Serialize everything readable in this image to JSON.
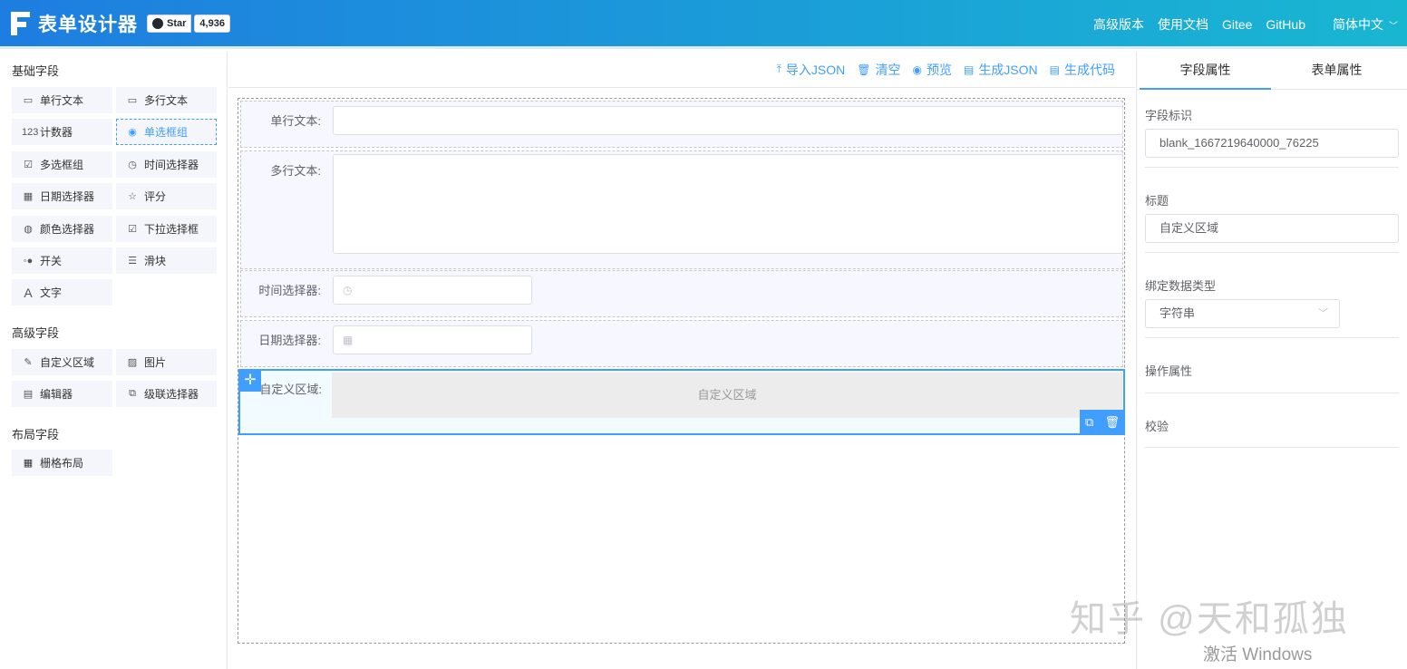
{
  "header": {
    "title": "表单设计器",
    "github": {
      "star_label": "Star",
      "count": "4,936"
    },
    "nav": [
      "高级版本",
      "使用文档",
      "Gitee",
      "GitHub",
      "简体中文"
    ]
  },
  "left": {
    "groups": [
      {
        "title": "基础字段",
        "items": [
          {
            "label": "单行文本",
            "icon": "input-icon"
          },
          {
            "label": "多行文本",
            "icon": "textarea-icon"
          },
          {
            "label": "计数器",
            "icon": "number-icon"
          },
          {
            "label": "单选框组",
            "icon": "radio-icon"
          },
          {
            "label": "多选框组",
            "icon": "checkbox-icon"
          },
          {
            "label": "时间选择器",
            "icon": "clock-icon"
          },
          {
            "label": "日期选择器",
            "icon": "calendar-icon"
          },
          {
            "label": "评分",
            "icon": "star-icon"
          },
          {
            "label": "颜色选择器",
            "icon": "palette-icon"
          },
          {
            "label": "下拉选择框",
            "icon": "select-icon"
          },
          {
            "label": "开关",
            "icon": "switch-icon"
          },
          {
            "label": "滑块",
            "icon": "slider-icon"
          },
          {
            "label": "文字",
            "icon": "text-icon"
          }
        ]
      },
      {
        "title": "高级字段",
        "items": [
          {
            "label": "自定义区域",
            "icon": "edit-icon"
          },
          {
            "label": "图片",
            "icon": "image-icon"
          },
          {
            "label": "编辑器",
            "icon": "editor-icon"
          },
          {
            "label": "级联选择器",
            "icon": "cascader-icon"
          }
        ]
      },
      {
        "title": "布局字段",
        "items": [
          {
            "label": "栅格布局",
            "icon": "grid-icon"
          }
        ]
      }
    ]
  },
  "toolbar": {
    "import_json": "导入JSON",
    "clear": "清空",
    "preview": "预览",
    "gen_json": "生成JSON",
    "gen_code": "生成代码"
  },
  "form": {
    "rows": [
      {
        "label": "单行文本:"
      },
      {
        "label": "多行文本:"
      },
      {
        "label": "时间选择器:"
      },
      {
        "label": "日期选择器:"
      },
      {
        "label": "自定义区域:",
        "content": "自定义区域"
      }
    ]
  },
  "right": {
    "tabs": [
      "字段属性",
      "表单属性"
    ],
    "field_id_label": "字段标识",
    "field_id_value": "blank_1667219640000_76225",
    "title_label": "标题",
    "title_value": "自定义区域",
    "data_type_label": "绑定数据类型",
    "data_type_value": "字符串",
    "actions_label": "操作属性",
    "validate_label": "校验"
  },
  "watermark": {
    "text": "知乎 @天和孤独",
    "windows": "激活 Windows"
  },
  "colors": {
    "accent": "#409eff",
    "header_start": "#1e7de0",
    "header_end": "#19b6d2"
  }
}
